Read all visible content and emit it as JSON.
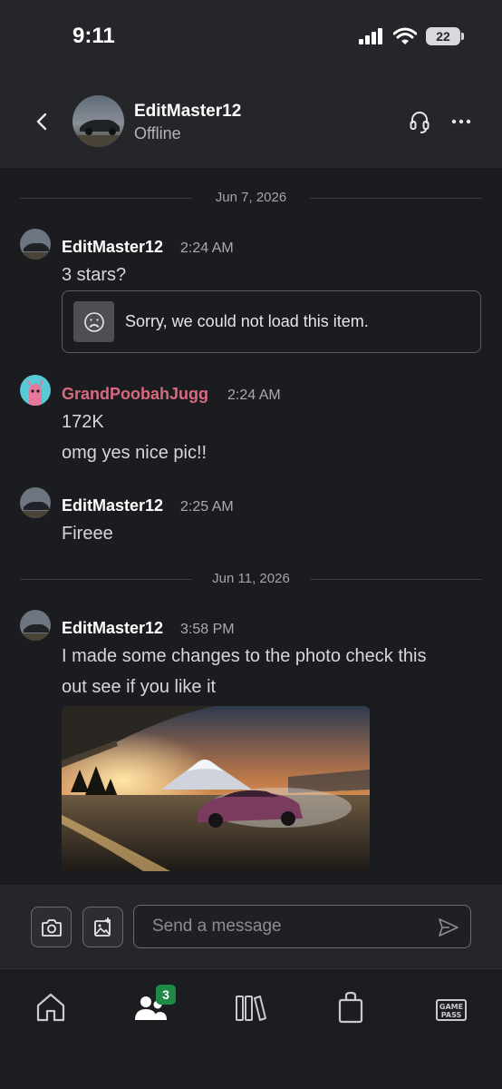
{
  "status_bar": {
    "time": "9:11",
    "battery": "22"
  },
  "header": {
    "name": "EditMaster12",
    "status": "Offline"
  },
  "messages": {
    "date1": "Jun 7, 2026",
    "m1": {
      "name": "EditMaster12",
      "time": "2:24 AM",
      "text": "3 stars?",
      "error": "Sorry, we could not load this item."
    },
    "m2": {
      "name": "GrandPoobahJugg",
      "time": "2:24 AM",
      "line1": "172K",
      "line2": "omg yes nice pic!!"
    },
    "m3": {
      "name": "EditMaster12",
      "time": "2:25 AM",
      "text": "Fireee"
    },
    "date2": "Jun 11, 2026",
    "m4": {
      "name": "EditMaster12",
      "time": "3:58 PM",
      "line1": "I made some changes to the photo check this",
      "line2": "out see if you like it"
    }
  },
  "composer": {
    "placeholder": "Send a message"
  },
  "tabbar": {
    "friends_badge": "3",
    "gamepass_line1": "GAME",
    "gamepass_line2": "PASS"
  },
  "colors": {
    "accent_badge": "#1e8a43",
    "gamer_pink": "#d86a80",
    "background": "#1b1c1f",
    "header": "#24262a"
  }
}
